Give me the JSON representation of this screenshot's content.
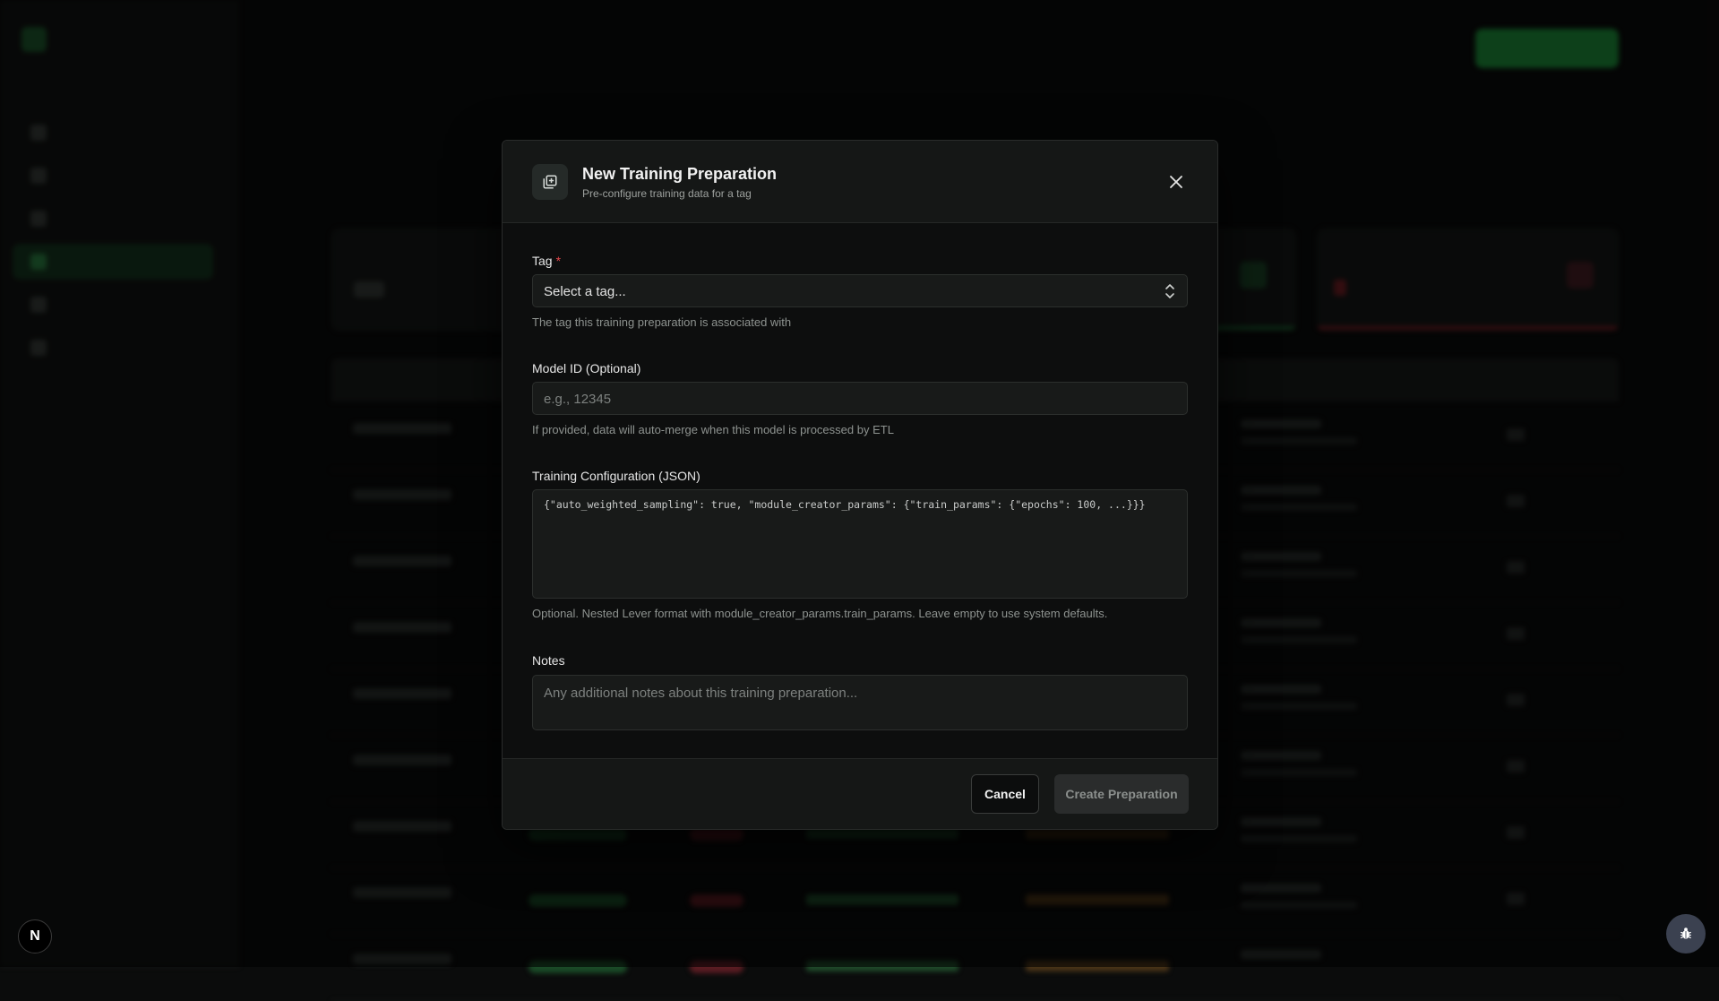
{
  "modal": {
    "title": "New Training Preparation",
    "subtitle": "Pre-configure training data for a tag",
    "icon": "add-stack-icon",
    "tag": {
      "label": "Tag",
      "required_mark": "*",
      "value": "Select a tag...",
      "help": "The tag this training preparation is associated with"
    },
    "model_id": {
      "label": "Model ID (Optional)",
      "placeholder": "e.g., 12345",
      "help": "If provided, data will auto-merge when this model is processed by ETL"
    },
    "training_config": {
      "label": "Training Configuration (JSON)",
      "placeholder": "{\"auto_weighted_sampling\": true, \"module_creator_params\": {\"train_params\": {\"epochs\": 100, ...}}}",
      "help": "Optional. Nested Lever format with module_creator_params.train_params. Leave empty to use system defaults."
    },
    "notes": {
      "label": "Notes",
      "placeholder": "Any additional notes about this training preparation..."
    },
    "buttons": {
      "cancel": "Cancel",
      "create": "Create Preparation"
    }
  },
  "badge": {
    "letter": "N"
  },
  "colors": {
    "required": "#e0464a",
    "accent": "#1f9a3e",
    "modal_bg": "#0d0e0e"
  }
}
